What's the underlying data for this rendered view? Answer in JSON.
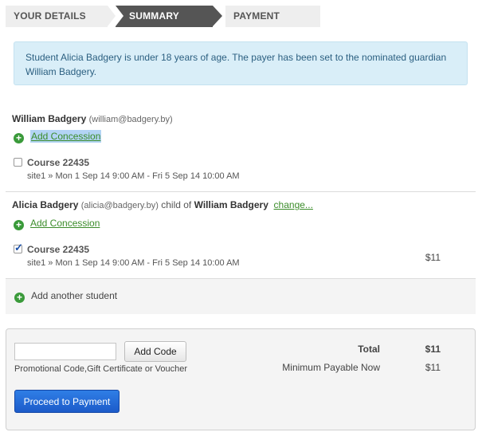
{
  "steps": [
    {
      "label": "YOUR DETAILS",
      "state": "done"
    },
    {
      "label": "SUMMARY",
      "state": "active"
    },
    {
      "label": "PAYMENT",
      "state": "pending"
    }
  ],
  "alert": {
    "text": "Student Alicia Badgery is under 18 years of age. The payer has been set to the nominated guardian William Badgery."
  },
  "students": [
    {
      "name": "William Badgery",
      "email": "(william@badgery.by)",
      "concession_label": "Add Concession",
      "course": {
        "title": "Course 22435",
        "details": "site1 » Mon 1 Sep 14 9:00 AM - Fri 5 Sep 14 10:00 AM",
        "checked": false
      }
    },
    {
      "name": "Alicia Badgery",
      "email": "(alicia@badgery.by)",
      "child_of_text": "child of",
      "guardian": "William Badgery",
      "change_label": "change...",
      "concession_label": "Add Concession",
      "course": {
        "title": "Course 22435",
        "details": "site1 » Mon 1 Sep 14 9:00 AM - Fri 5 Sep 14 10:00 AM",
        "checked": true,
        "price": "$11"
      }
    }
  ],
  "add_student_label": "Add another student",
  "payment": {
    "code_input_value": "",
    "add_code_label": "Add Code",
    "code_help": "Promotional Code,Gift Certificate or Voucher",
    "total_label": "Total",
    "total_value": "$11",
    "min_payable_label": "Minimum Payable Now",
    "min_payable_value": "$11",
    "proceed_label": "Proceed to Payment"
  },
  "colors": {
    "active_step": "#555555",
    "alert_bg": "#d9eef8",
    "link_green": "#3b8c2a",
    "proceed_blue": "#1c5bc9"
  },
  "icons": [
    "add-circle-icon",
    "checkbox-icon"
  ]
}
